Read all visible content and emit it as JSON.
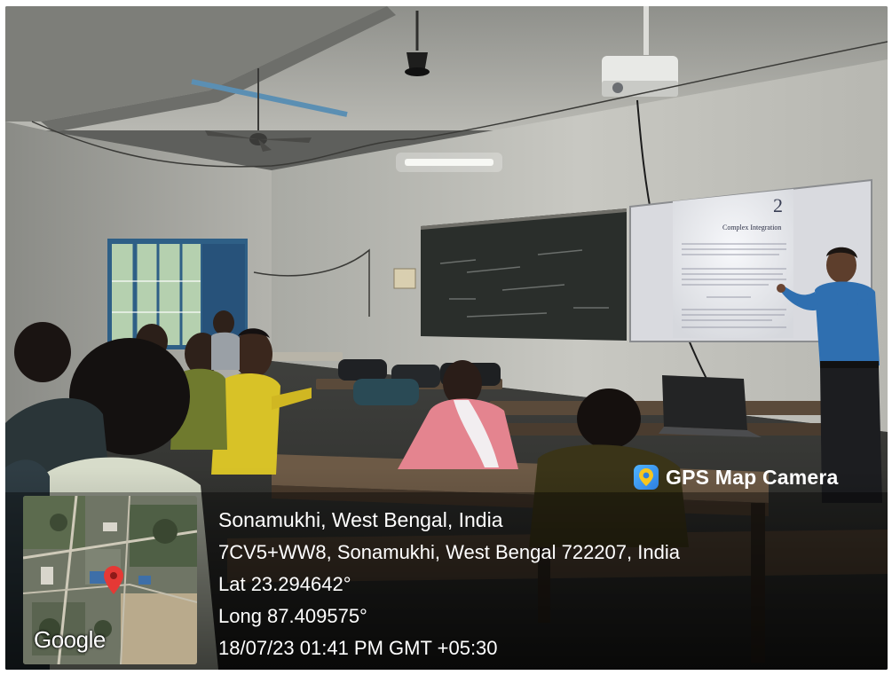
{
  "watermark": {
    "brand": "GPS Map Camera",
    "brand_icon": "map-pin-icon",
    "map_logo": "Google",
    "place_title": "Sonamukhi, West Bengal, India",
    "address": "7CV5+WW8, Sonamukhi, West Bengal 722207, India",
    "latitude": "Lat 23.294642°",
    "longitude": "Long 87.409575°",
    "datetime": "18/07/23 01:41 PM GMT +05:30"
  },
  "projected_slide": {
    "chapter_number": "2",
    "chapter_title": "Complex Integration"
  },
  "colors": {
    "panel_overlay": "#000000",
    "map_pin": "#e53935",
    "shirt_blue": "#2f6fb0",
    "shirt_yellow": "#d8c227"
  }
}
